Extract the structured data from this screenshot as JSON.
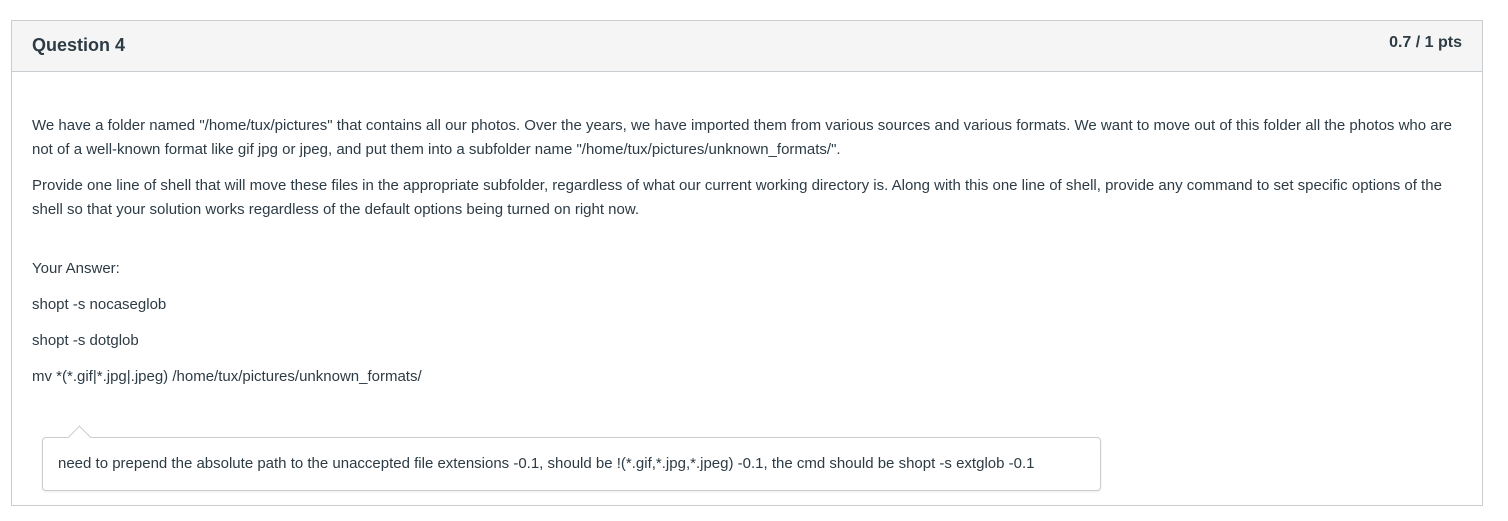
{
  "question": {
    "title": "Question 4",
    "points": "0.7 / 1 pts",
    "paragraphs": [
      "We have a folder named \"/home/tux/pictures\" that contains all our photos. Over the years, we have imported them from various sources and various formats. We want to move out of this folder all the photos who are not of a well-known format like gif jpg or jpeg, and put them into a subfolder name \"/home/tux/pictures/unknown_formats/\".",
      "Provide one line of shell that will move these files in the appropriate subfolder, regardless of what our current working directory is. Along with this one line of shell, provide any command to set specific options of the shell so that your solution works regardless of the default options being turned on right now."
    ]
  },
  "answer": {
    "label": "Your Answer:",
    "lines": [
      "shopt -s nocaseglob",
      "shopt -s dotglob",
      "mv *(*.gif|*.jpg|.jpeg) /home/tux/pictures/unknown_formats/"
    ]
  },
  "comment": {
    "text": "need to prepend the absolute path to the unaccepted file extensions -0.1, should be !(*.gif,*.jpg,*.jpeg) -0.1, the cmd should be shopt -s extglob -0.1"
  }
}
